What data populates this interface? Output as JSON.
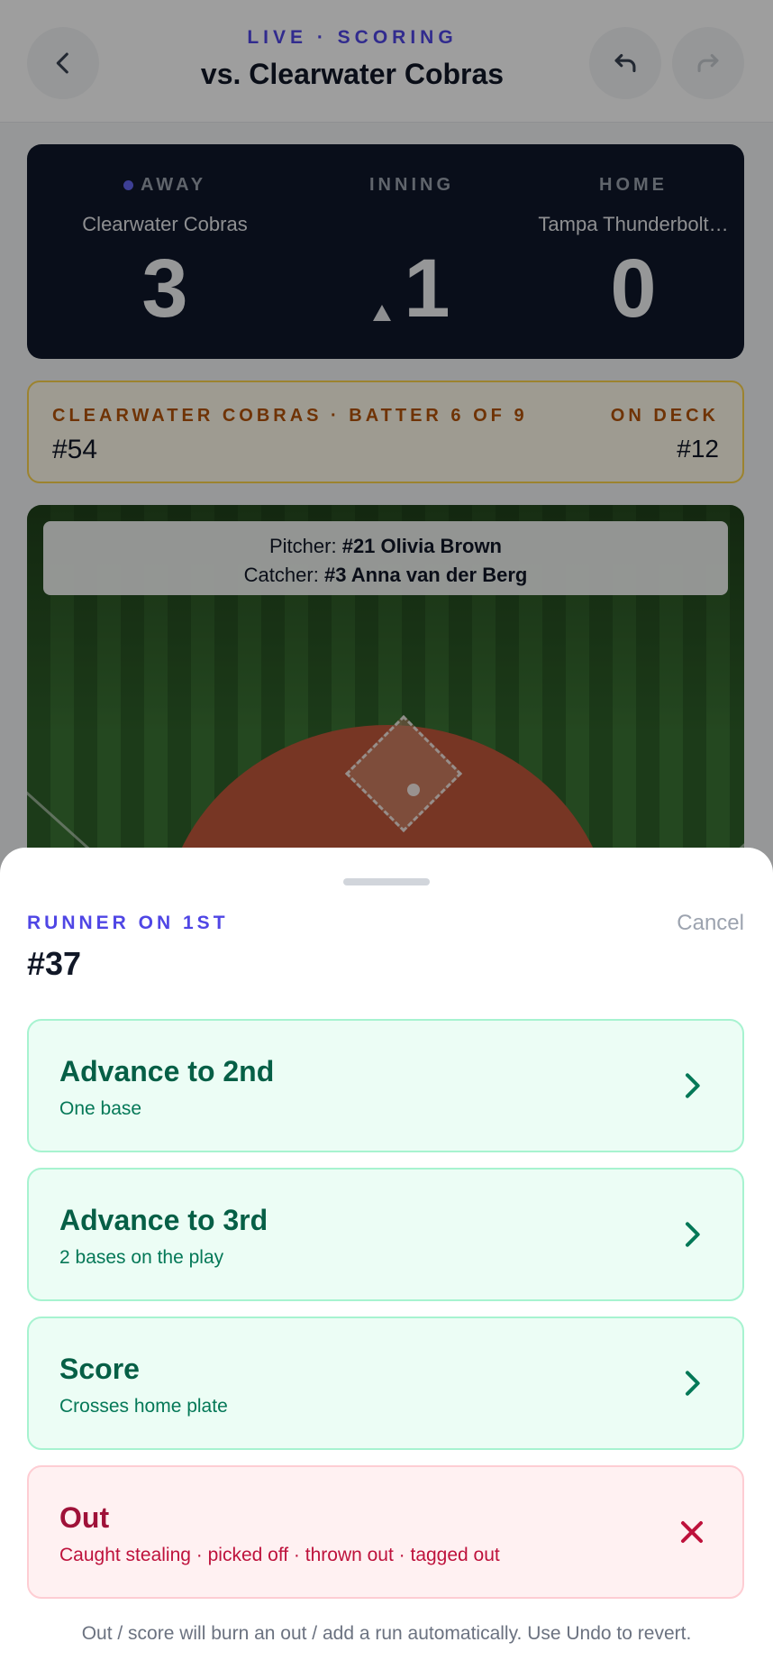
{
  "header": {
    "kicker": "LIVE · SCORING",
    "title": "vs. Clearwater Cobras"
  },
  "scoreboard": {
    "away_label": "AWAY",
    "away_team": "Clearwater Cobras",
    "away_score": "3",
    "inning_label": "INNING",
    "inning": "1",
    "inning_half": "top",
    "home_label": "HOME",
    "home_team": "Tampa Thunderbolt…",
    "home_score": "0"
  },
  "batter": {
    "kicker": "CLEARWATER COBRAS · BATTER 6 OF 9",
    "number": "#54",
    "on_deck_label": "ON DECK",
    "on_deck_number": "#12"
  },
  "field": {
    "pitcher_label": "Pitcher:",
    "pitcher": "#21 Olivia Brown",
    "catcher_label": "Catcher:",
    "catcher": "#3 Anna van der Berg"
  },
  "sheet": {
    "kicker": "RUNNER ON 1ST",
    "runner": "#37",
    "cancel": "Cancel",
    "options": [
      {
        "title": "Advance to 2nd",
        "subtitle": "One base",
        "icon": "chevron-right-icon"
      },
      {
        "title": "Advance to 3rd",
        "subtitle": "2 bases on the play",
        "icon": "chevron-right-icon"
      },
      {
        "title": "Score",
        "subtitle": "Crosses home plate",
        "icon": "chevron-right-icon"
      },
      {
        "title": "Out",
        "subtitle": "Caught stealing · picked off · thrown out · tagged out",
        "icon": "close-icon"
      }
    ],
    "footnote": "Out / score will burn an out / add a run automatically. Use Undo to revert."
  },
  "colors": {
    "accent": "#4f46e5",
    "scoreboard_bg": "#0f172a",
    "advance": "#065f46",
    "out": "#9f1239",
    "batter_accent": "#b45309"
  }
}
